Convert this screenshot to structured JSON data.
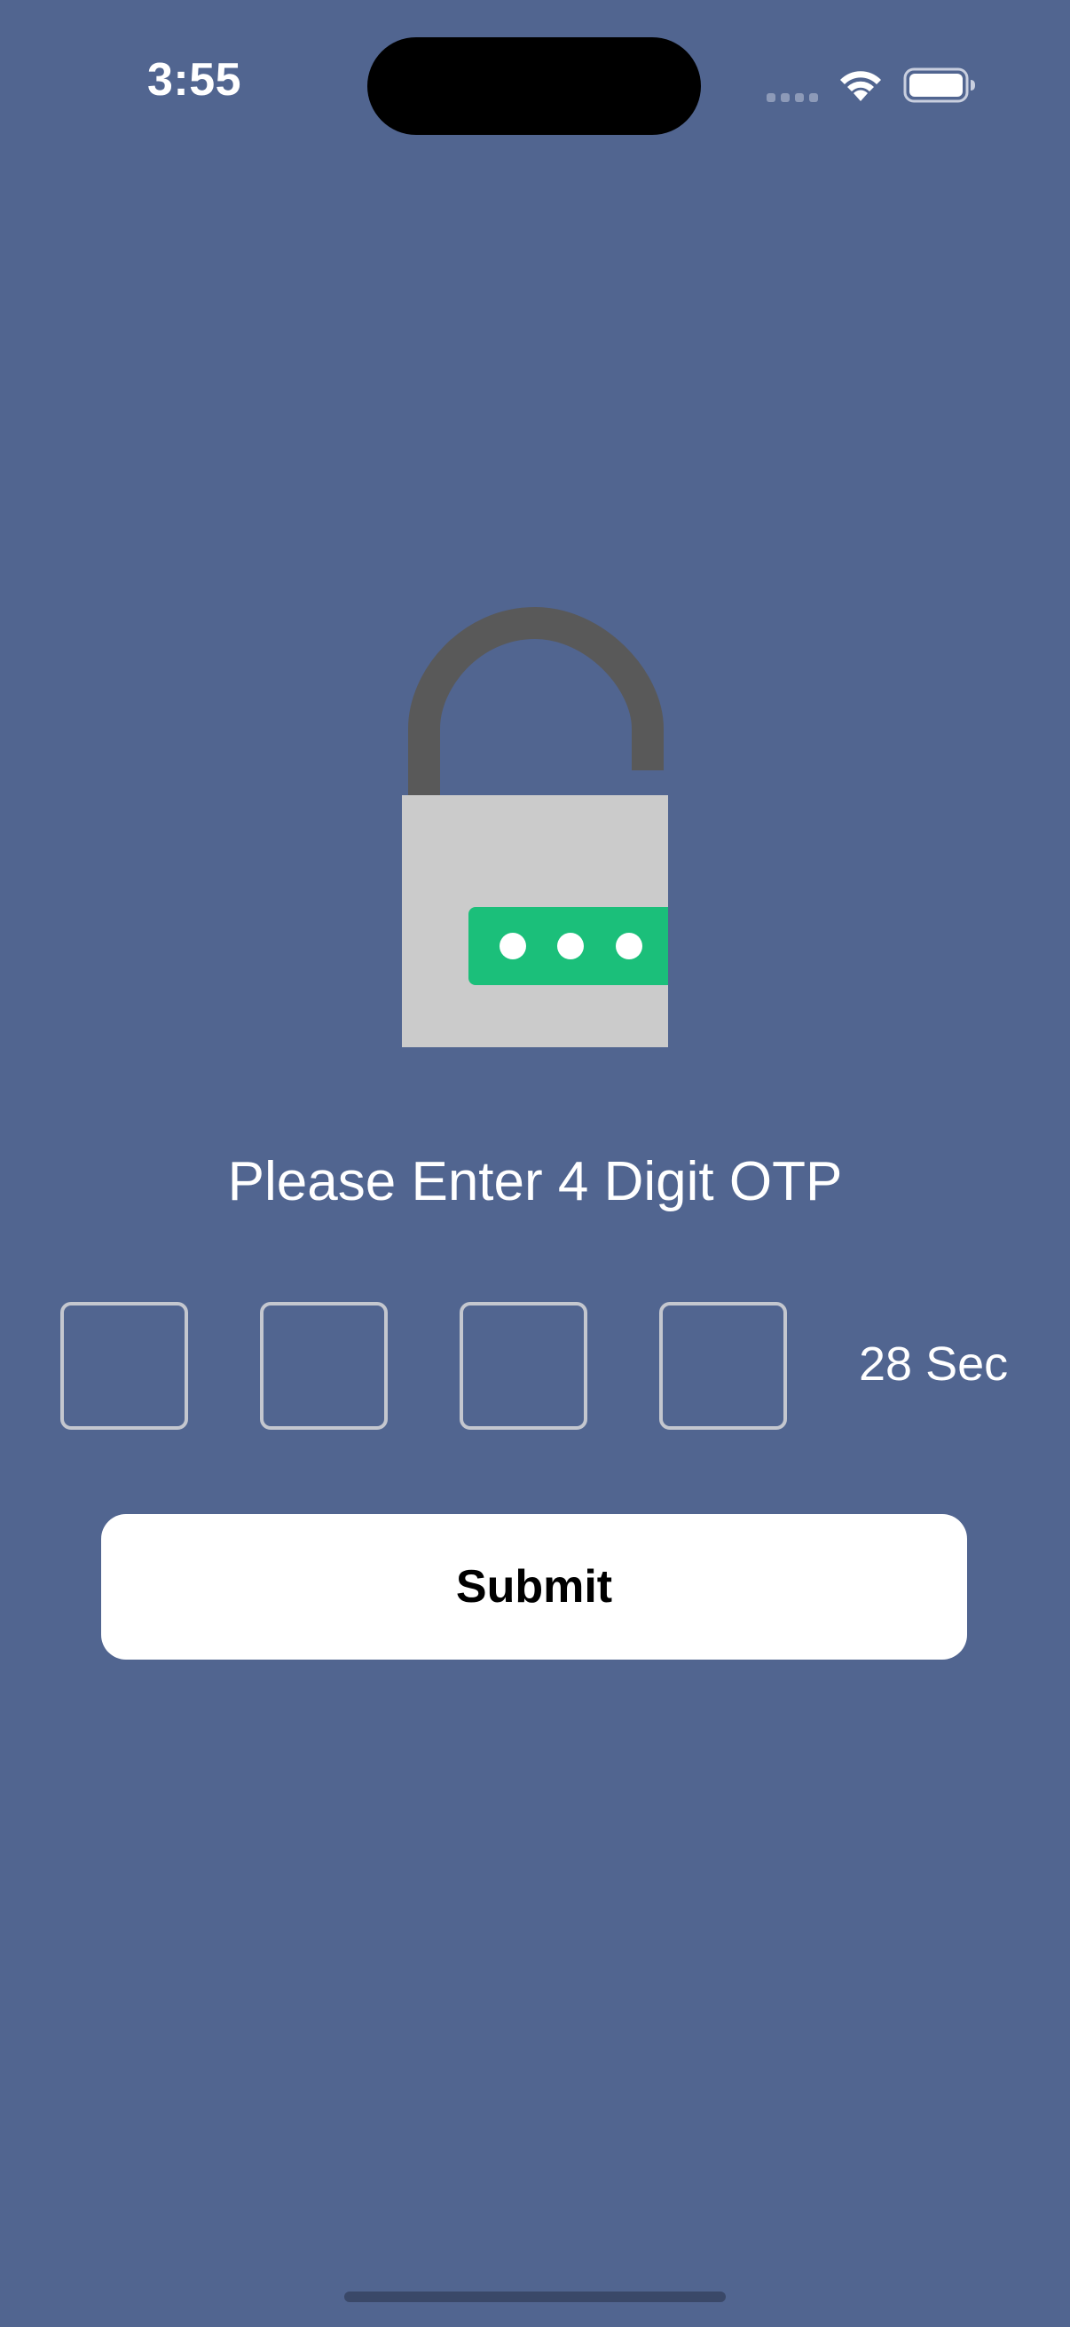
{
  "status_bar": {
    "time": "3:55",
    "icons": [
      "cellular-signal-icon",
      "wifi-icon",
      "battery-icon"
    ]
  },
  "illustration": {
    "icon": "padlock-icon",
    "colors": {
      "shackle": "#595959",
      "body": "#cbcbcb",
      "password_bar": "#1bbf7a",
      "dots": "#ffffff"
    }
  },
  "otp": {
    "title": "Please Enter 4 Digit OTP",
    "digits": [
      "",
      "",
      "",
      ""
    ],
    "timer": "28 Sec"
  },
  "actions": {
    "submit_label": "Submit"
  },
  "theme": {
    "background": "#516590",
    "button_bg": "#ffffff",
    "box_border": "#c4c7cf"
  }
}
